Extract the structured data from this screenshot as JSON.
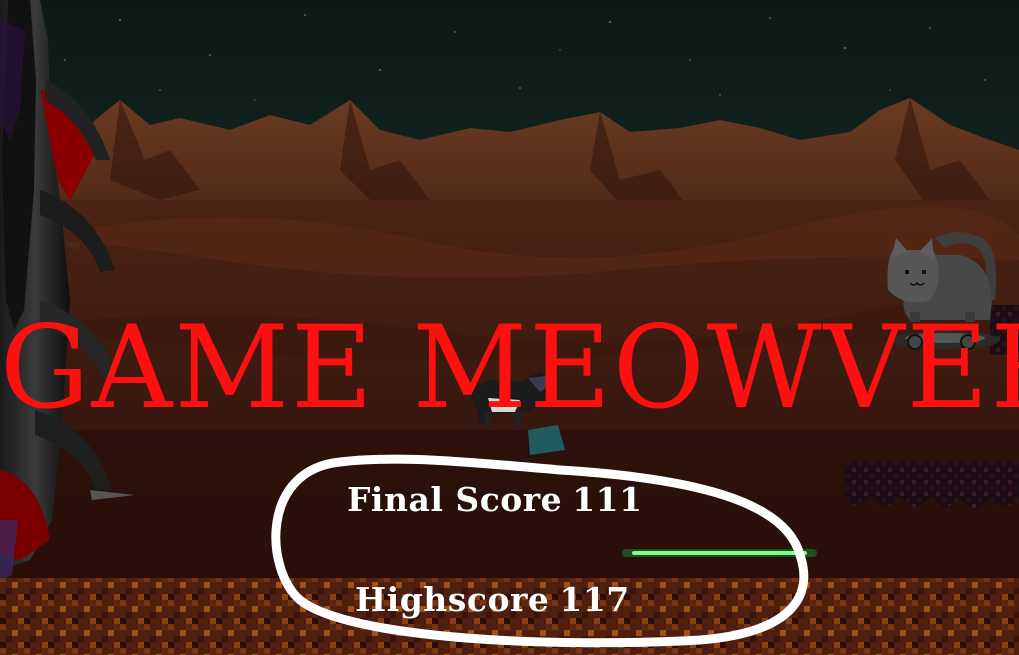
{
  "game_over": {
    "title": "GAME MEOWVER",
    "final_score_label": "Final Score",
    "final_score_value": "111",
    "highscore_label": "Highscore",
    "highscore_value": "117"
  },
  "colors": {
    "title": "#ff1010",
    "score_text": "#ffffff",
    "sky": "#0b1714",
    "ground": "#5a2410",
    "laser": "#33dd44"
  }
}
